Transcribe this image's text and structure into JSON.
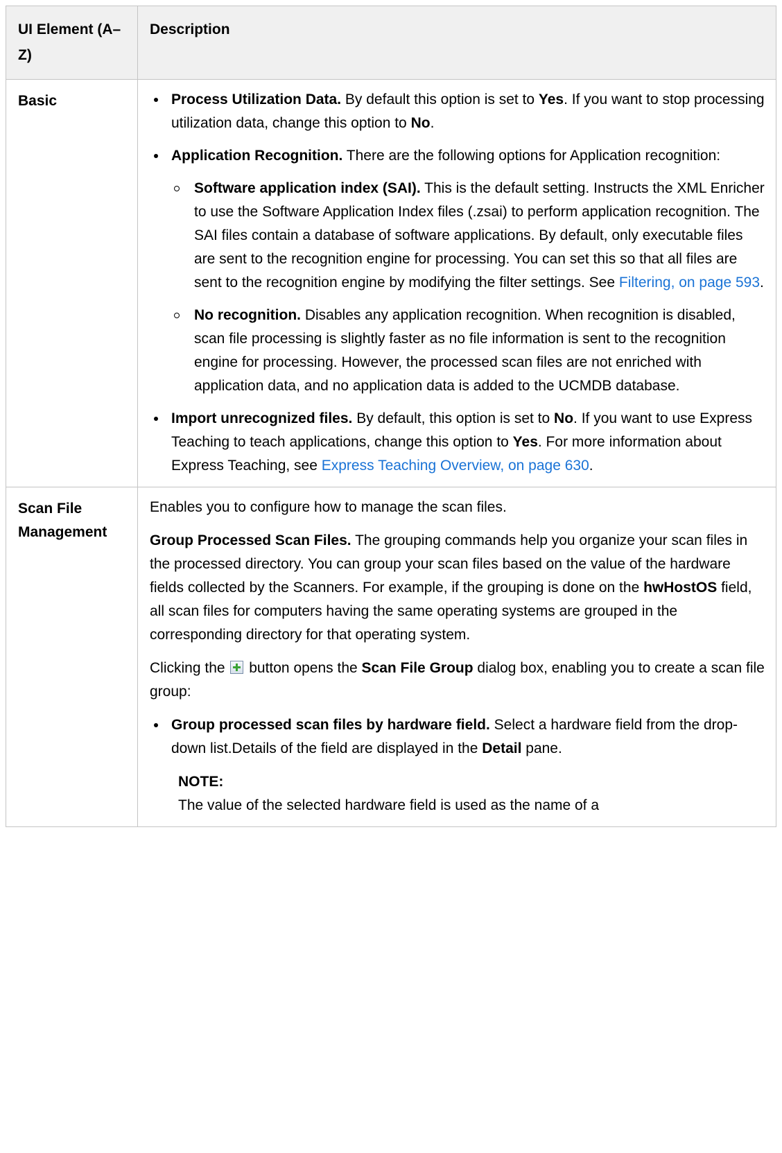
{
  "header": {
    "col1": "UI Element (A–Z)",
    "col2": "Description"
  },
  "basic": {
    "label": "Basic",
    "process_util": {
      "title": "Process Utilization Data.",
      "text1": " By default this option is set to ",
      "yes": "Yes",
      "text2": ". If you want to stop processing utilization data, change this option to ",
      "no": "No",
      "text3": "."
    },
    "app_recog": {
      "title": "Application Recognition.",
      "text": " There are the following options for Application recognition:",
      "sai": {
        "title": "Software application index (SAI).",
        "text": " This is the default setting. Instructs the XML Enricher to use the Software Application Index files (.zsai) to perform application recognition. The SAI files contain a database of software applications. By default, only executable files are sent to the recognition engine for processing. You can set this so that all files are sent to the recognition engine by modifying the filter settings. See ",
        "link": "Filtering, on page 593",
        "end": "."
      },
      "none": {
        "title": "No recognition.",
        "text": " Disables any application recognition. When recognition is disabled, scan file processing is slightly faster as no file information is sent to the recognition engine for processing. However, the processed scan files are not enriched with application data, and no application data is added to the UCMDB database."
      }
    },
    "import_unrec": {
      "title": "Import unrecognized files.",
      "text1": " By default, this option is set to ",
      "no": "No",
      "text2": ". If you want to use Express Teaching to teach applications, change this option to ",
      "yes": "Yes",
      "text3": ". For more information about Express Teaching, see ",
      "link": "Express Teaching Overview, on page 630",
      "end": "."
    }
  },
  "scan": {
    "label": "Scan File Management",
    "intro": "Enables you to configure how to manage the scan files.",
    "group": {
      "title": "Group Processed Scan Files.",
      "text1": " The grouping commands help you organize your scan files in the processed directory. You can group your scan files based on the value of the hardware fields collected by the Scanners. For example, if the grouping is done on the ",
      "field": "hwHostOS",
      "text2": " field, all scan files for computers having the same operating systems are grouped in the corresponding directory for that operating system."
    },
    "clicking": {
      "text1": "Clicking the ",
      "icon": "add-icon",
      "text2": " button opens the ",
      "dialog": "Scan File Group",
      "text3": " dialog box, enabling you to create a scan file group:"
    },
    "by_hw": {
      "title": "Group processed scan files by hardware field.",
      "text1": " Select a hardware field from the drop-down list.Details of the field are displayed in the ",
      "pane": "Detail",
      "text2": " pane."
    },
    "note": {
      "title": "NOTE:",
      "text": "The value of the selected hardware field is used as the name of a"
    }
  }
}
